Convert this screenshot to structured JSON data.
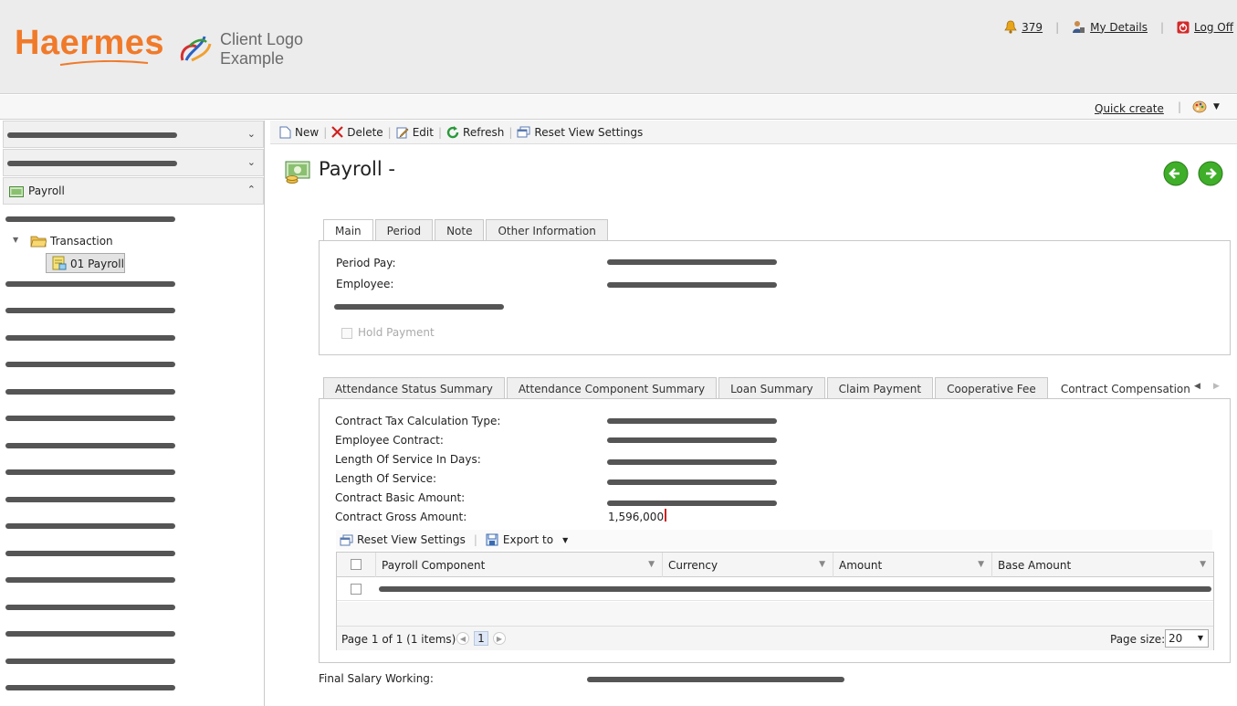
{
  "header": {
    "brand": "Haermes",
    "client_logo_line1": "Client Logo",
    "client_logo_line2": "Example",
    "notifications_count": "379",
    "my_details": "My Details",
    "log_off": "Log Off"
  },
  "subbar": {
    "quick_create": "Quick create"
  },
  "sidebar": {
    "payroll_header": "Payroll",
    "tree": {
      "folder": "Transaction",
      "selected_item": "01 Payroll"
    }
  },
  "toolbar": {
    "new": "New",
    "delete": "Delete",
    "edit": "Edit",
    "refresh": "Refresh",
    "reset_view": "Reset View Settings"
  },
  "page": {
    "title": "Payroll -"
  },
  "tabs_top": [
    "Main",
    "Period",
    "Note",
    "Other Information"
  ],
  "main_form": {
    "period_pay_label": "Period Pay:",
    "employee_label": "Employee:",
    "hold_payment_label": "Hold Payment"
  },
  "tabs_bottom": [
    "Attendance Status Summary",
    "Attendance Component Summary",
    "Loan Summary",
    "Claim Payment",
    "Cooperative Fee",
    "Contract Compensation"
  ],
  "contract_form": {
    "tax_calc_type_label": "Contract Tax Calculation Type:",
    "employee_contract_label": "Employee Contract:",
    "length_days_label": "Length Of Service In Days:",
    "length_label": "Length Of Service:",
    "basic_amount_label": "Contract Basic Amount:",
    "gross_amount_label": "Contract Gross Amount:",
    "gross_amount_value": "1,596,000"
  },
  "grid": {
    "reset_view": "Reset View Settings",
    "export": "Export to",
    "columns": [
      "Payroll Component",
      "Currency",
      "Amount",
      "Base Amount"
    ],
    "pager_info": "Page 1 of 1 (1 items)",
    "current_page": "1",
    "page_size_label": "Page size:",
    "page_size_value": "20"
  },
  "footer_form": {
    "final_salary_label": "Final Salary Working:"
  },
  "colors": {
    "brand_orange": "#f07a2a",
    "nav_green": "#3fae29",
    "accent_red": "#cc2222"
  }
}
